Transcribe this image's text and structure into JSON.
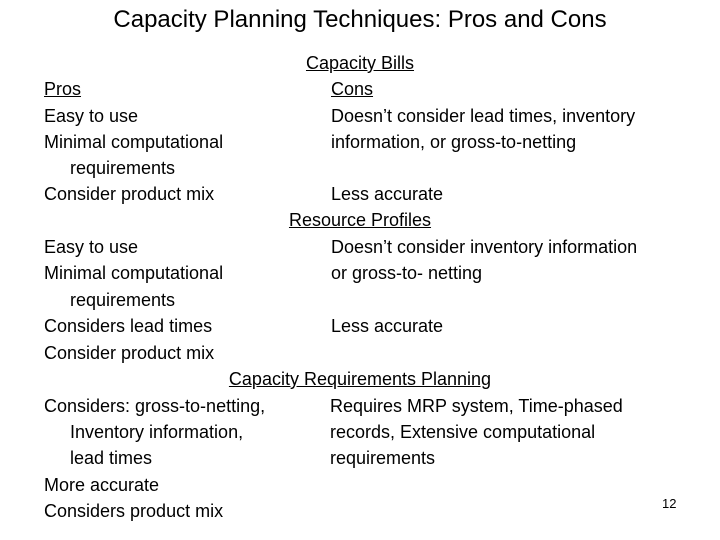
{
  "slide": {
    "title": "Capacity Planning Techniques: Pros and Cons",
    "page_number": "12"
  },
  "sections": [
    {
      "heading": "Capacity Bills",
      "pros_label": "Pros",
      "cons_label": "Cons",
      "pros": [
        "Easy to use",
        "Minimal computational",
        "requirements",
        "Consider product mix"
      ],
      "cons": [
        "Doesn’t consider lead times, inventory",
        "information, or gross-to-netting",
        "Less accurate"
      ]
    },
    {
      "heading": "Resource Profiles",
      "pros": [
        "Easy to use",
        "Minimal computational",
        "requirements",
        "Considers lead times",
        "Consider product mix"
      ],
      "cons": [
        "Doesn’t consider inventory information",
        "or gross-to- netting",
        "Less accurate"
      ]
    },
    {
      "heading": "Capacity Requirements Planning",
      "pros": [
        "Considers: gross-to-netting,",
        "Inventory information,",
        "lead times",
        "More accurate",
        "Considers product mix"
      ],
      "cons": [
        "Requires MRP system, Time-phased",
        "records, Extensive computational",
        "requirements"
      ]
    }
  ]
}
